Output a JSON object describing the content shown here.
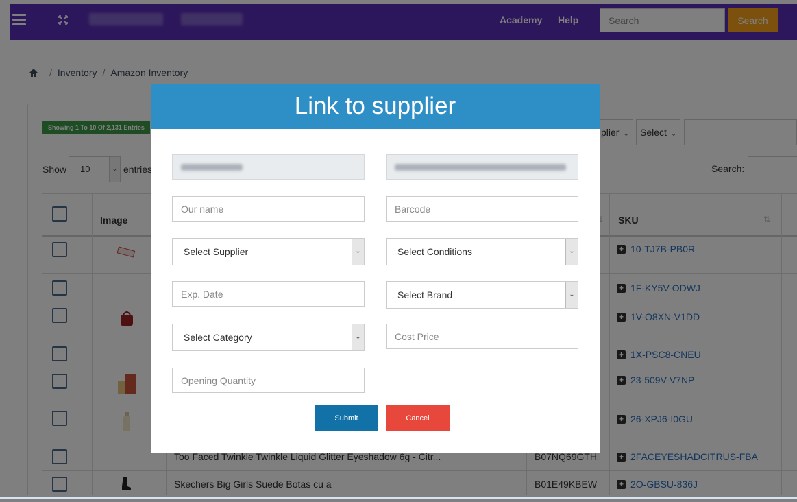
{
  "topbar": {
    "academy_label": "Academy",
    "help_label": "Help",
    "search_placeholder": "Search",
    "search_button_label": "Search",
    "brand_color": "#5b2fb8",
    "search_button_color": "#f7a21b"
  },
  "breadcrumb": {
    "items": [
      "Inventory",
      "Amazon Inventory"
    ]
  },
  "listing": {
    "showing_text": "Showing 1 To 10 Of 2,131 Entries",
    "show_label": "Show",
    "entries_value": "10",
    "entries_label": "entries",
    "supplier_filter_text": "plier",
    "select_filter_text": "Select",
    "search_label": "Search:"
  },
  "table": {
    "headers": {
      "image": "Image",
      "sku": "SKU"
    },
    "rows": [
      {
        "sku": "10-TJ7B-PB0R",
        "title": "",
        "asin": ""
      },
      {
        "sku": "1F-KY5V-ODWJ",
        "title": "",
        "asin": ""
      },
      {
        "sku": "1V-O8XN-V1DD",
        "title": "",
        "asin": ""
      },
      {
        "sku": "1X-PSC8-CNEU",
        "title": "",
        "asin": ""
      },
      {
        "sku": "23-509V-V7NP",
        "title": "",
        "asin": ""
      },
      {
        "sku": "26-XPJ6-I0GU",
        "title": "",
        "asin": ""
      },
      {
        "sku": "2FACEYESHADCITRUS-FBA",
        "title": "Too Faced Twinkle Twinkle Liquid Glitter Eyeshadow 6g - Citr...",
        "asin": "B07NQ69GTH"
      },
      {
        "sku": "2O-GBSU-836J",
        "title": "Skechers Big Girls Suede Botas cu a",
        "asin": "B01E49KBEW"
      }
    ]
  },
  "modal": {
    "title": "Link to supplier",
    "our_name_placeholder": "Our name",
    "barcode_placeholder": "Barcode",
    "select_supplier": "Select Supplier",
    "select_conditions": "Select Conditions",
    "exp_date_placeholder": "Exp. Date",
    "select_brand": "Select Brand",
    "select_category": "Select Category",
    "cost_price_placeholder": "Cost Price",
    "opening_quantity_placeholder": "Opening Quantity",
    "submit_label": "Submit",
    "cancel_label": "Cancel",
    "header_color": "#2e8fc7",
    "submit_color": "#1272a8",
    "cancel_color": "#e8473b"
  }
}
